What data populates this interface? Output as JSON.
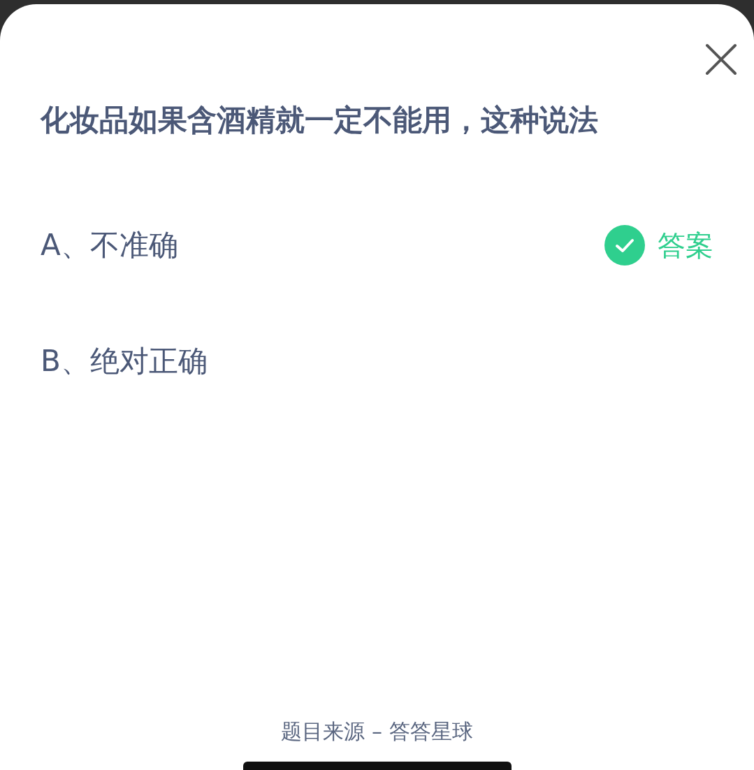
{
  "question": "化妆品如果含酒精就一定不能用，这种说法",
  "options": [
    {
      "label": "A、不准确",
      "correct": true
    },
    {
      "label": "B、绝对正确",
      "correct": false
    }
  ],
  "answer_label": "答案",
  "footer": "题目来源 – 答答星球"
}
